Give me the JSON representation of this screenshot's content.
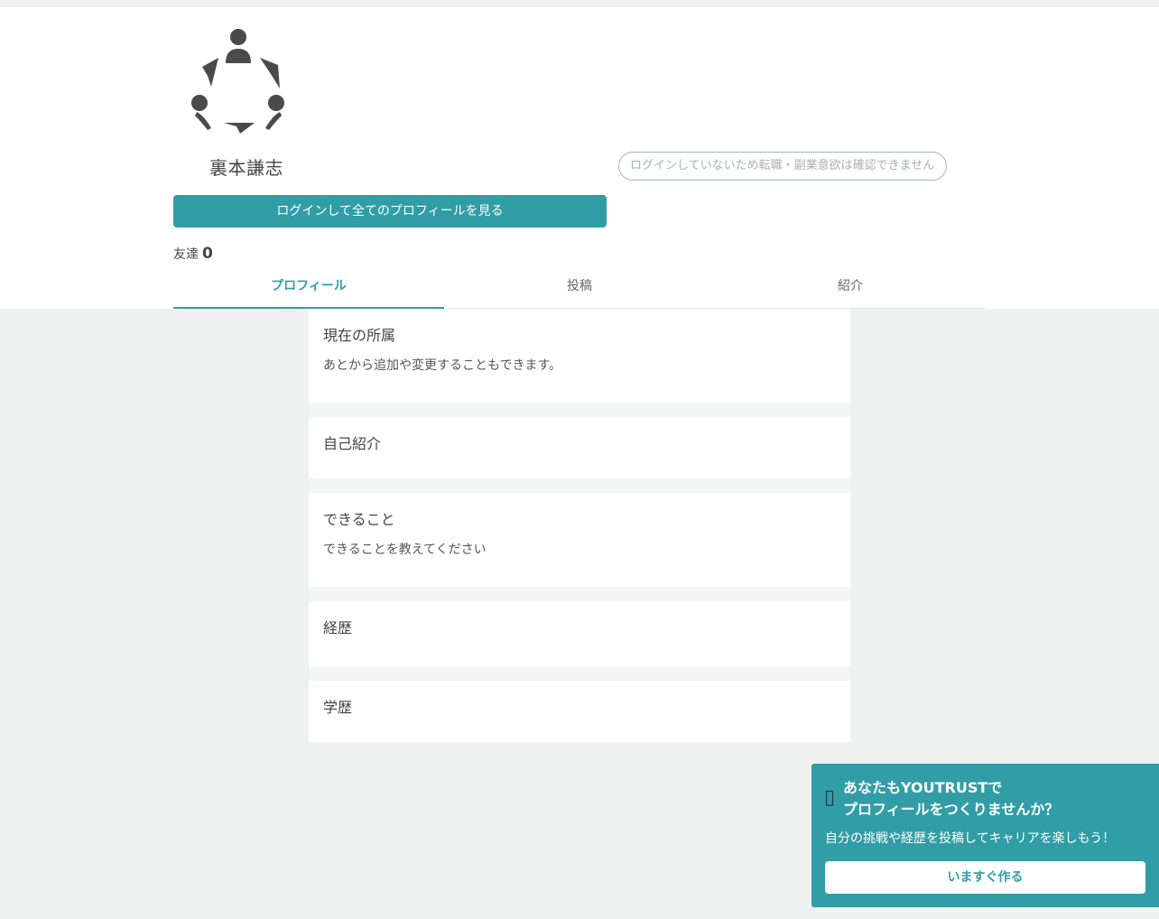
{
  "profile": {
    "name": "裏本謙志",
    "intent_placeholder": "ログインしていないため転職・副業意欲は確認できません",
    "login_button": "ログインして全てのプロフィールを見る",
    "friends_label": "友達",
    "friends_count": "0"
  },
  "tabs": [
    {
      "label": "プロフィール",
      "active": true
    },
    {
      "label": "投稿",
      "active": false
    },
    {
      "label": "紹介",
      "active": false
    }
  ],
  "sections": [
    {
      "title": "現在の所属",
      "desc": "あとから追加や変更することもできます。"
    },
    {
      "title": "自己紹介",
      "desc": ""
    },
    {
      "title": "できること",
      "desc": "できることを教えてください"
    },
    {
      "title": "経歴",
      "desc": ""
    },
    {
      "title": "学歴",
      "desc": ""
    }
  ],
  "promo": {
    "heading_line1": "あなたもYOUTRUSTで",
    "heading_line2": "プロフィールをつくりませんか？",
    "sub": "自分の挑戦や経歴を投稿してキャリアを楽しもう！",
    "cta": "いますぐ作る"
  },
  "colors": {
    "accent": "#319da6",
    "page_bg": "#eff1f0"
  }
}
